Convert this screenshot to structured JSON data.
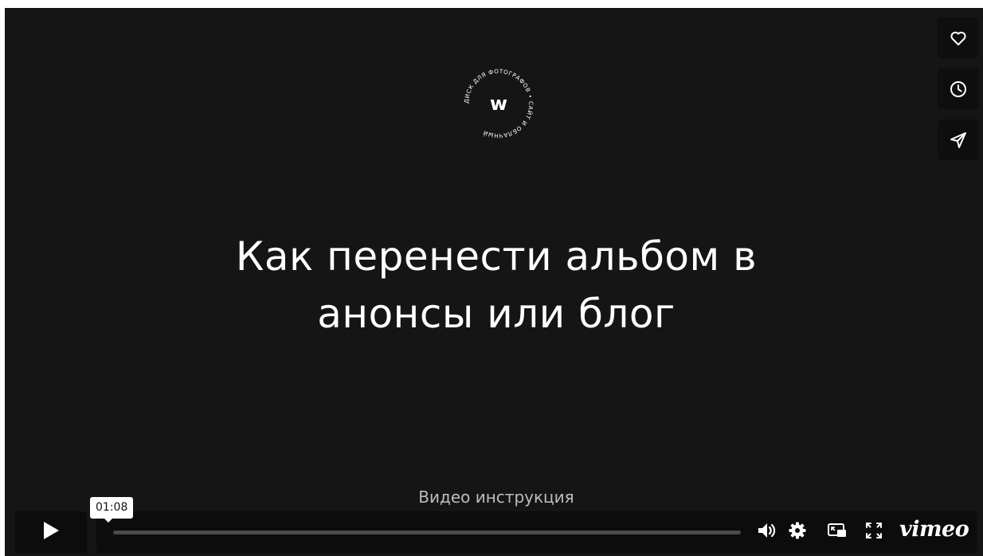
{
  "video": {
    "title_line1": "Как перенести альбом в",
    "title_line2": "анонсы или блог",
    "subtitle": "Видео инструкция"
  },
  "logo": {
    "letter": "w",
    "ring_text": "ДИСК ДЛЯ ФОТОГРАФОВ • САЙТ И ОБЛАЧНЫЙ"
  },
  "side_actions": [
    {
      "icon": "heart-icon"
    },
    {
      "icon": "clock-icon"
    },
    {
      "icon": "paper-plane-icon"
    }
  ],
  "controls": {
    "hover_time": "01:08",
    "brand": "vimeo",
    "icons": [
      "play-icon",
      "volume-icon",
      "gear-icon",
      "pip-icon",
      "fullscreen-icon"
    ]
  },
  "colors": {
    "player_bg": "#151515",
    "button_bg": "#0c0c0c",
    "track": "#4a4a4a",
    "text": "#ffffff"
  }
}
